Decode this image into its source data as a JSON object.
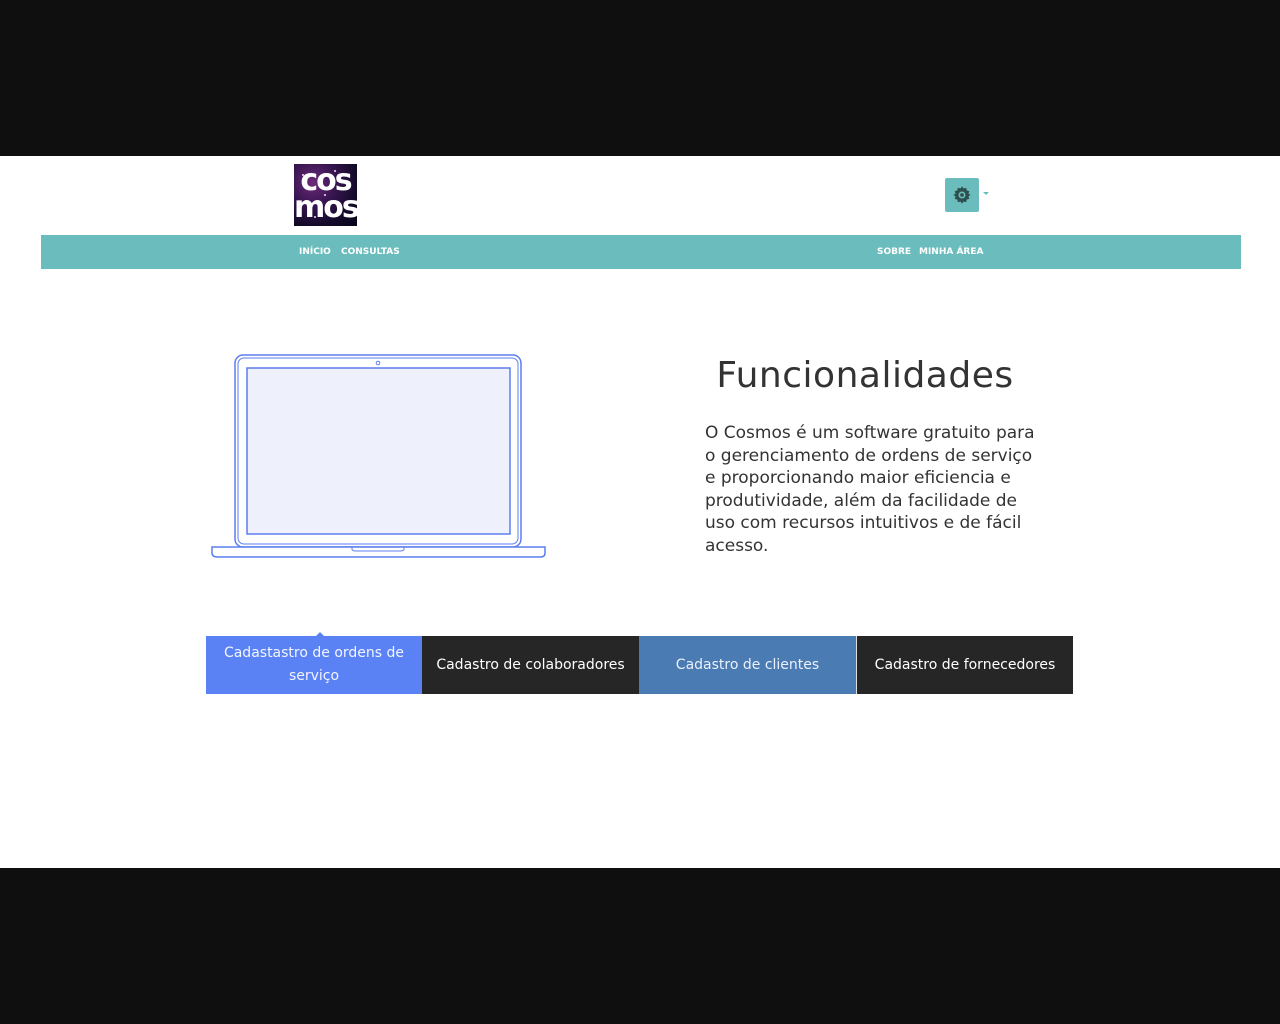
{
  "header": {
    "logo_line1": "cos",
    "logo_line2": "mos",
    "settings_icon": "gear-icon"
  },
  "nav": {
    "left": [
      {
        "label": "INÍCIO"
      },
      {
        "label": "CONSULTAS"
      }
    ],
    "right": [
      {
        "label": "SOBRE"
      },
      {
        "label": "MINHA ÁREA"
      }
    ]
  },
  "hero": {
    "image": "laptop-illustration",
    "title": "Funcionalidades",
    "description": "O Cosmos é um software gratuito para o gerenciamento de ordens de serviço e proporcionando maior eficiencia e produtividade, além da facilidade de uso com recursos intuitivos e de fácil acesso."
  },
  "tabs": [
    {
      "label": "Cadastastro de ordens de serviço",
      "active": true
    },
    {
      "label": "Cadastro de colaboradores",
      "active": false
    },
    {
      "label": "Cadastro de clientes",
      "active": false
    },
    {
      "label": "Cadastro de fornecedores",
      "active": false
    }
  ],
  "colors": {
    "accent_teal": "#6bbdbd",
    "tab_active_blue": "#5b82f5",
    "tab_dark": "#262626",
    "tab_steel_blue": "#4a7bb3",
    "laptop_stroke": "#5b7ef0",
    "laptop_screen": "#eef1fb"
  }
}
